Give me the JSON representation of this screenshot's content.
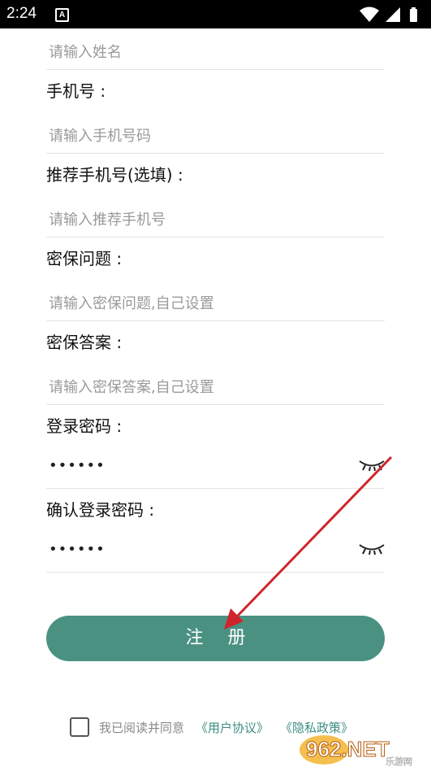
{
  "status_bar": {
    "time": "2:24",
    "notification": "A"
  },
  "form": {
    "name_placeholder": "请输入姓名",
    "phone_label": "手机号 :",
    "phone_placeholder": "请输入手机号码",
    "referrer_label": "推荐手机号(选填) :",
    "referrer_placeholder": "请输入推荐手机号",
    "security_question_label": "密保问题 :",
    "security_question_placeholder": "请输入密保问题,自己设置",
    "security_answer_label": "密保答案 :",
    "security_answer_placeholder": "请输入密保答案,自己设置",
    "password_label": "登录密码 :",
    "password_value": "••••••",
    "confirm_label": "确认登录密码 :",
    "confirm_value": "••••••"
  },
  "register_button": "注册",
  "agreement": {
    "text": "我已阅读并同意",
    "user_agreement": "《用户协议》",
    "privacy_policy": "《隐私政策》"
  },
  "watermark": {
    "brand": "962.NET",
    "sub": "乐游网"
  },
  "colors": {
    "accent": "#4a9182",
    "link": "#3d8d83",
    "arrow": "#d0242b"
  }
}
